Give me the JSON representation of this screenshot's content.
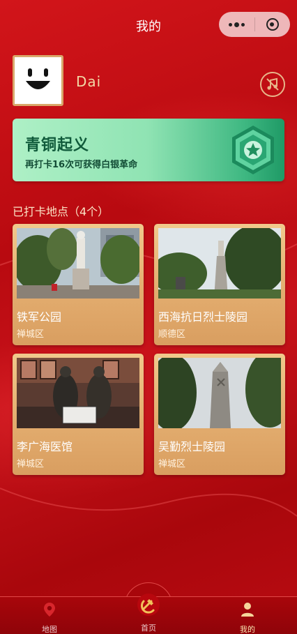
{
  "header": {
    "title": "我的"
  },
  "capsule": {
    "more_icon": "more-dots-icon",
    "close_icon": "miniprogram-close-icon"
  },
  "profile": {
    "username": "Dai",
    "avatar_icon": "smiley-face-icon",
    "music_icon": "music-off-icon"
  },
  "medal": {
    "title": "青铜起义",
    "subtitle": "再打卡16次可获得白银革命",
    "badge_icon": "star-hexagon-badge-icon"
  },
  "checkins": {
    "title": "已打卡地点（4个）",
    "places": [
      {
        "name": "铁军公园",
        "district": "禅城区",
        "photo": "statue-park-photo"
      },
      {
        "name": "西海抗日烈士陵园",
        "district": "顺德区",
        "photo": "memorial-stairs-photo"
      },
      {
        "name": "李广海医馆",
        "district": "禅城区",
        "photo": "bronze-sculpture-photo"
      },
      {
        "name": "吴勤烈士陵园",
        "district": "禅城区",
        "photo": "monument-tower-photo"
      }
    ]
  },
  "tabbar": {
    "items": [
      {
        "label": "地图",
        "icon": "map-pin-icon",
        "active": false
      },
      {
        "label": "首页",
        "icon": "party-emblem-icon",
        "active": false
      },
      {
        "label": "我的",
        "icon": "user-icon",
        "active": true
      }
    ]
  },
  "colors": {
    "primary_red": "#b8070e",
    "gold": "#e3ad6f",
    "medal_green": "#3fb882"
  }
}
